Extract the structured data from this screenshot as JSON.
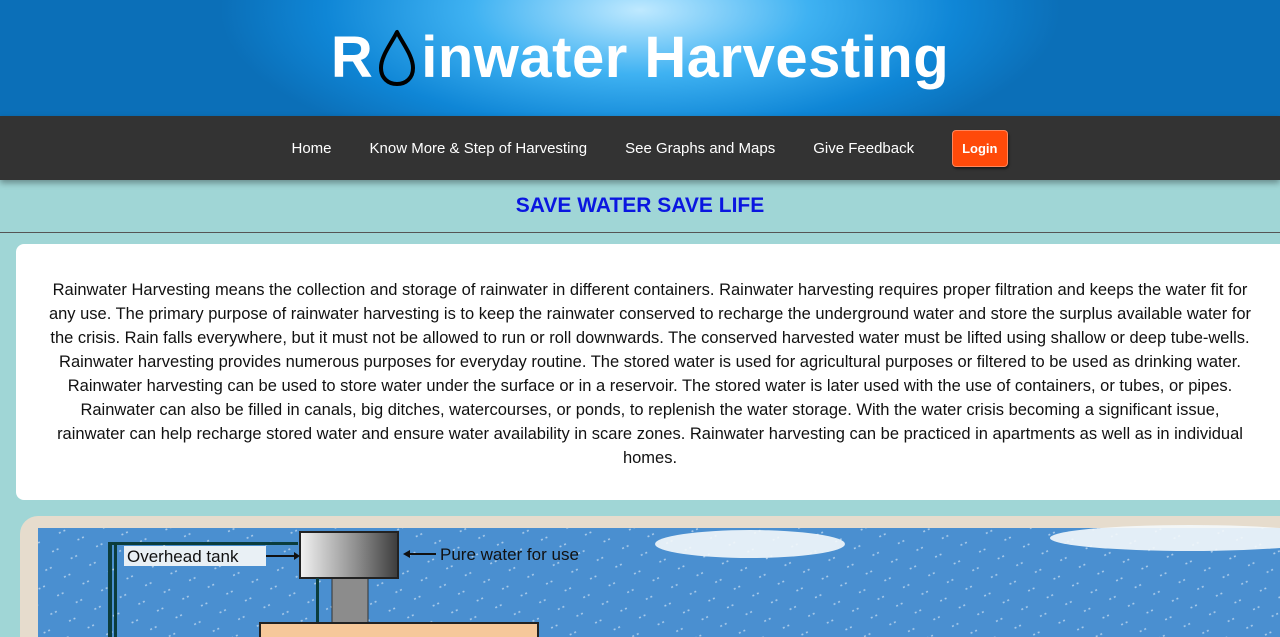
{
  "header": {
    "title_prefix": "R",
    "title_suffix": "inwater Harvesting",
    "drop_icon": "water-drop-icon"
  },
  "nav": {
    "items": [
      {
        "label": "Home"
      },
      {
        "label": "Know More & Step of Harvesting"
      },
      {
        "label": "See Graphs and Maps"
      },
      {
        "label": "Give Feedback"
      }
    ],
    "login_label": "Login"
  },
  "slogan": "SAVE WATER SAVE LIFE",
  "intro_text": "Rainwater Harvesting means the collection and storage of rainwater in different containers. Rainwater harvesting requires proper filtration and keeps the water fit for any use. The primary purpose of rainwater harvesting is to keep the rainwater conserved to recharge the underground water and store the surplus available water for the crisis. Rain falls everywhere, but it must not be allowed to run or roll downwards. The conserved harvested water must be lifted using shallow or deep tube-wells. Rainwater harvesting provides numerous purposes for everyday routine. The stored water is used for agricultural purposes or filtered to be used as drinking water. Rainwater harvesting can be used to store water under the surface or in a reservoir. The stored water is later used with the use of containers, or tubes, or pipes. Rainwater can also be filled in canals, big ditches, watercourses, or ponds, to replenish the water storage. With the water crisis becoming a significant issue, rainwater can help recharge stored water and ensure water availability in scare zones. Rainwater harvesting can be practiced in apartments as well as in individual homes.",
  "diagram": {
    "label_overhead_tank": "Overhead tank",
    "label_pure_water": "Pure water for use"
  },
  "colors": {
    "header_blue": "#0f86d6",
    "nav_bg": "#333333",
    "login_bg": "#ff4a0a",
    "slogan": "#0a16e0",
    "page_bg": "#a0d6d6",
    "sky": "#4a8fd0"
  }
}
